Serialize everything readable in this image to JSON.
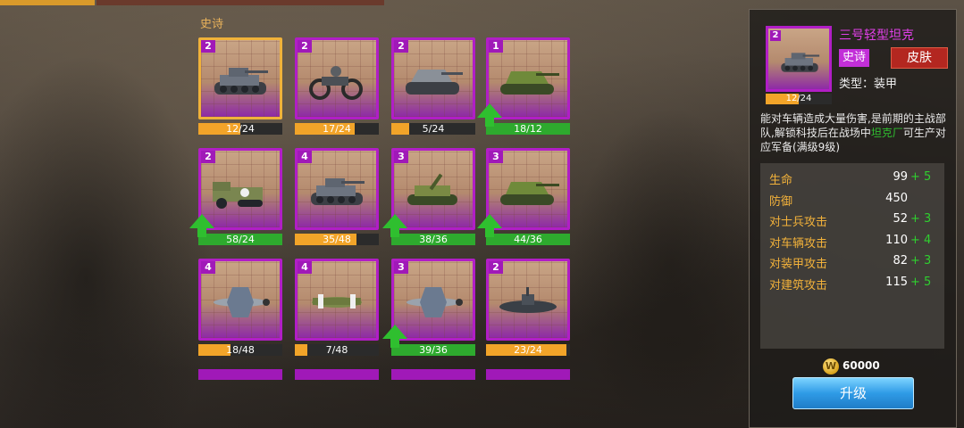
{
  "section": {
    "title": "史诗"
  },
  "cards": [
    {
      "id": "c1",
      "stars": "2",
      "progress": "12/24",
      "fraction": 0.5,
      "full": false,
      "upgrade": false,
      "selected": true,
      "icon": "tank-icon"
    },
    {
      "id": "c2",
      "stars": "2",
      "progress": "17/24",
      "fraction": 0.71,
      "full": false,
      "upgrade": false,
      "selected": false,
      "icon": "motorcycle-icon"
    },
    {
      "id": "c3",
      "stars": "2",
      "progress": "5/24",
      "fraction": 0.21,
      "full": false,
      "upgrade": false,
      "selected": false,
      "icon": "assault-gun-icon"
    },
    {
      "id": "c4",
      "stars": "1",
      "progress": "18/12",
      "fraction": 1.0,
      "full": true,
      "upgrade": true,
      "selected": false,
      "icon": "tank-destroyer-icon"
    },
    {
      "id": "c5",
      "stars": "2",
      "progress": "58/24",
      "fraction": 1.0,
      "full": true,
      "upgrade": true,
      "selected": false,
      "icon": "halftrack-icon"
    },
    {
      "id": "c6",
      "stars": "4",
      "progress": "35/48",
      "fraction": 0.73,
      "full": false,
      "upgrade": false,
      "selected": false,
      "icon": "tank-icon"
    },
    {
      "id": "c7",
      "stars": "3",
      "progress": "38/36",
      "fraction": 1.0,
      "full": true,
      "upgrade": true,
      "selected": false,
      "icon": "artillery-icon"
    },
    {
      "id": "c8",
      "stars": "3",
      "progress": "44/36",
      "fraction": 1.0,
      "full": true,
      "upgrade": true,
      "selected": false,
      "icon": "tank-destroyer-icon"
    },
    {
      "id": "c9",
      "stars": "4",
      "progress": "18/48",
      "fraction": 0.38,
      "full": false,
      "upgrade": false,
      "selected": false,
      "icon": "fighter-plane-icon"
    },
    {
      "id": "c10",
      "stars": "4",
      "progress": "7/48",
      "fraction": 0.15,
      "full": false,
      "upgrade": false,
      "selected": false,
      "icon": "bomber-plane-icon"
    },
    {
      "id": "c11",
      "stars": "3",
      "progress": "39/36",
      "fraction": 1.0,
      "full": true,
      "upgrade": true,
      "selected": false,
      "icon": "fighter-plane-icon"
    },
    {
      "id": "c12",
      "stars": "2",
      "progress": "23/24",
      "fraction": 0.96,
      "full": false,
      "upgrade": false,
      "selected": false,
      "icon": "submarine-icon"
    }
  ],
  "detail": {
    "name": "三号轻型坦克",
    "stars": "2",
    "progress": "12/24",
    "fraction": 0.5,
    "rarity": "史诗",
    "skin_label": "皮肤",
    "type_text": "类型：装甲",
    "desc_before": "能对车辆造成大量伤害,是前期的主战部队,解锁科技后在战场中",
    "desc_highlight": "坦克厂",
    "desc_after": "可生产对应军备(满级9级)",
    "stats": [
      {
        "label": "生命",
        "value": "99",
        "bonus": "+ 5"
      },
      {
        "label": "防御",
        "value": "450",
        "bonus": ""
      },
      {
        "label": "对士兵攻击",
        "value": "52",
        "bonus": "+ 3"
      },
      {
        "label": "对车辆攻击",
        "value": "110",
        "bonus": "+ 4"
      },
      {
        "label": "对装甲攻击",
        "value": "82",
        "bonus": "+ 3"
      },
      {
        "label": "对建筑攻击",
        "value": "115",
        "bonus": "+ 5"
      }
    ],
    "coin_icon_text": "W",
    "cost": "60000",
    "upgrade_label": "升级"
  }
}
